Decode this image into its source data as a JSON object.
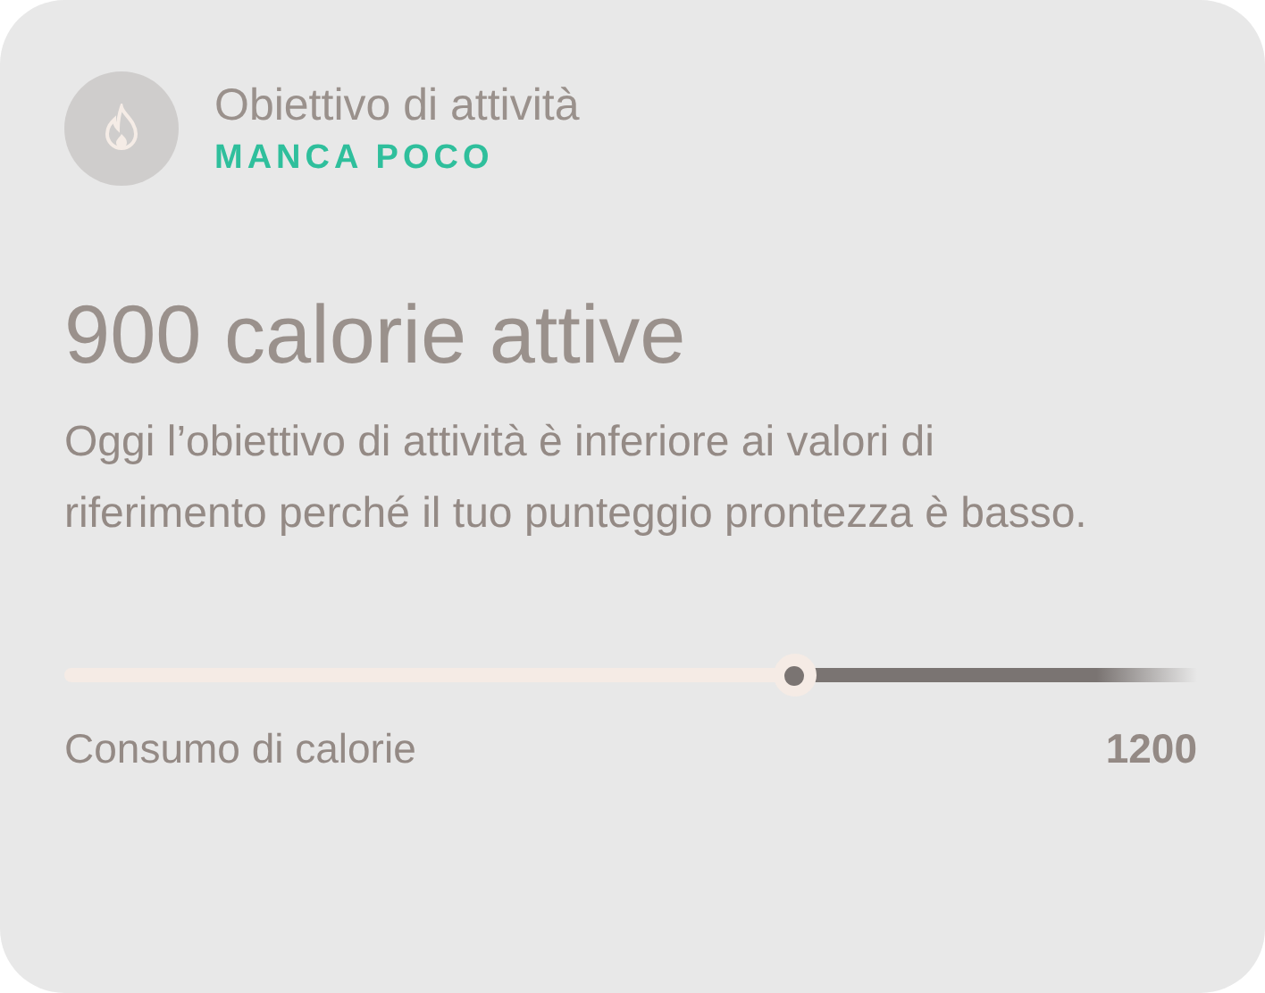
{
  "header": {
    "title": "Obiettivo di attività",
    "status": "MANCA POCO"
  },
  "headline": "900 calorie attive",
  "description": "Oggi l’obiettivo di attività è inferiore ai valori di riferimento perché il tuo punteggio prontezza è basso.",
  "slider": {
    "level": 0.645,
    "label": "Consumo di calorie",
    "reading": "1200"
  }
}
